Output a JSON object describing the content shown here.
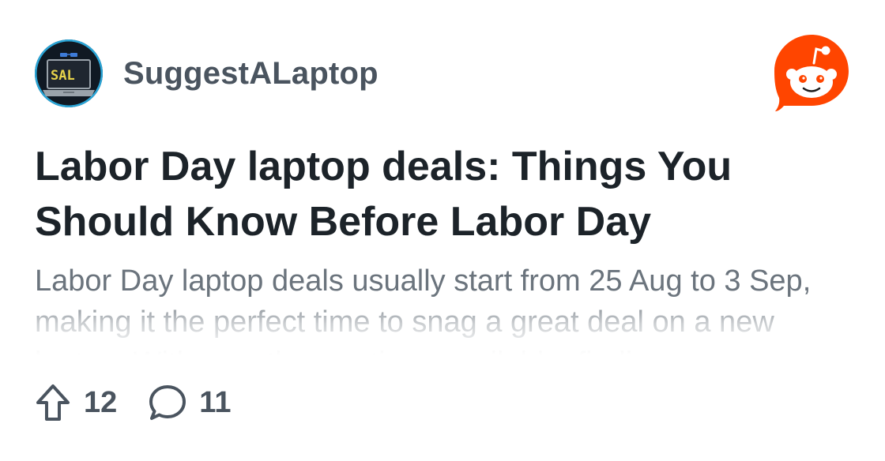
{
  "post": {
    "subreddit": "SuggestALaptop",
    "avatar_text": "SAL",
    "title": "Labor Day laptop deals: Things You Should Know Before Labor Day",
    "body": "Labor Day laptop deals usually start from 25 Aug to 3 Sep, making it the perfect time to snag a great deal on a new laptop. With countless options available, finding",
    "upvotes": "12",
    "comments": "11"
  },
  "icons": {
    "avatar": "subreddit-avatar",
    "brand": "reddit-logo-icon",
    "upvote": "upvote-arrow-icon",
    "comment": "comment-bubble-icon"
  },
  "colors": {
    "reddit_orange": "#ff4500",
    "title": "#1c2329",
    "meta": "#4a545f",
    "body": "#6b747d"
  }
}
